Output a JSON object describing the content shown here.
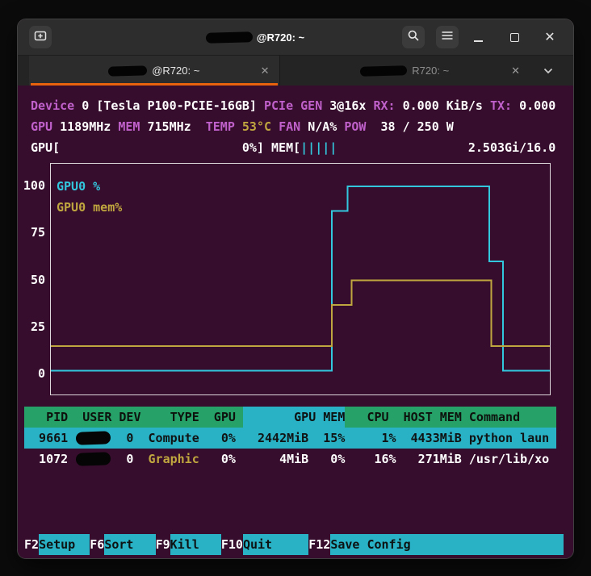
{
  "colors": {
    "terminal_bg": "#360d2c",
    "accent": "#e8620d",
    "magenta": "#c061cb",
    "cyan": "#33c7de",
    "cyan_bg": "#29b2c6",
    "yellow": "#c0a63f",
    "green": "#26a269"
  },
  "window": {
    "title": "@R720: ~",
    "close_glyph": "✕",
    "tab_close_glyph": "✕"
  },
  "tabs": [
    {
      "label": "@R720: ~",
      "active": true
    },
    {
      "label": "R720: ~",
      "active": false
    }
  ],
  "terminal": {
    "line_device": [
      {
        "t": "Device",
        "s": "label"
      },
      {
        "t": " 0 [Tesla P100-PCIE-16GB] ",
        "s": "val"
      },
      {
        "t": "PCIe GEN ",
        "s": "label"
      },
      {
        "t": "3@16x ",
        "s": "val"
      },
      {
        "t": "RX: ",
        "s": "label"
      },
      {
        "t": "0.000 KiB/s ",
        "s": "val"
      },
      {
        "t": "TX: ",
        "s": "label"
      },
      {
        "t": "0.000",
        "s": "val"
      }
    ],
    "line_clocks": [
      {
        "t": "GPU ",
        "s": "label"
      },
      {
        "t": "1189MHz ",
        "s": "val"
      },
      {
        "t": "MEM ",
        "s": "label"
      },
      {
        "t": "715MHz  ",
        "s": "val"
      },
      {
        "t": "TEMP ",
        "s": "label"
      },
      {
        "t": "53°C ",
        "s": "yellow"
      },
      {
        "t": "FAN ",
        "s": "label"
      },
      {
        "t": "N/A% ",
        "s": "val"
      },
      {
        "t": "POW  ",
        "s": "label"
      },
      {
        "t": "38 / 250 W",
        "s": "val"
      }
    ],
    "line_bars": [
      {
        "t": "GPU[                         0%] MEM[",
        "s": "val"
      },
      {
        "t": "|||||",
        "s": "cyan"
      },
      {
        "t": "                  2.503Gi/16.0",
        "s": "val"
      }
    ]
  },
  "chart_data": {
    "type": "line",
    "title": "",
    "xlabel": "",
    "ylabel": "",
    "ylim": [
      0,
      100
    ],
    "yticks": [
      100,
      75,
      50,
      25,
      0
    ],
    "grid": false,
    "legend_position": "top-left",
    "series": [
      {
        "name": "GPU0 %",
        "color": "#33c7de",
        "points": [
          [
            0,
            2
          ],
          [
            56.3,
            2
          ],
          [
            56.3,
            87
          ],
          [
            59.5,
            87
          ],
          [
            59.5,
            100
          ],
          [
            87.9,
            100
          ],
          [
            87.9,
            60
          ],
          [
            90.6,
            60
          ],
          [
            90.6,
            2
          ],
          [
            100,
            2
          ]
        ]
      },
      {
        "name": "GPU0 mem%",
        "color": "#c0a63f",
        "points": [
          [
            0,
            15
          ],
          [
            56.3,
            15
          ],
          [
            56.3,
            37
          ],
          [
            60.3,
            37
          ],
          [
            60.3,
            50
          ],
          [
            88.3,
            50
          ],
          [
            88.3,
            15
          ],
          [
            100,
            15
          ]
        ]
      }
    ]
  },
  "process_table": {
    "header": [
      {
        "t": "   PID  USER DEV    TYPE  GPU ",
        "s": "hdr"
      },
      {
        "t": "       GPU MEM",
        "s": "hdrsort"
      },
      {
        "t": "   CPU  HOST MEM Command     ",
        "s": "hdr"
      }
    ],
    "row_selected": [
      {
        "t": "  9661 ",
        "s": "sel"
      },
      {
        "r": 5,
        "s": "sel"
      },
      {
        "t": "  0  Compute   0%   2442MiB  15%     1%  4433MiB python laun ",
        "s": "sel"
      }
    ],
    "row_2": [
      {
        "t": "  1072 ",
        "s": "val"
      },
      {
        "r": 5,
        "s": "val"
      },
      {
        "t": "  0  ",
        "s": "val"
      },
      {
        "t": "Graphic",
        "s": "yellow"
      },
      {
        "t": "   0%      4MiB   0%    16%   271MiB /usr/lib/xo",
        "s": "val"
      }
    ]
  },
  "function_bar": [
    {
      "t": "F2",
      "s": "key"
    },
    {
      "t": "Setup  ",
      "s": "fn"
    },
    {
      "t": "F6",
      "s": "key"
    },
    {
      "t": "Sort   ",
      "s": "fn"
    },
    {
      "t": "F9",
      "s": "key"
    },
    {
      "t": "Kill   ",
      "s": "fn"
    },
    {
      "t": "F10",
      "s": "key"
    },
    {
      "t": "Quit     ",
      "s": "fn"
    },
    {
      "t": "F12",
      "s": "key"
    },
    {
      "t": "Save Config                     ",
      "s": "fn"
    }
  ]
}
